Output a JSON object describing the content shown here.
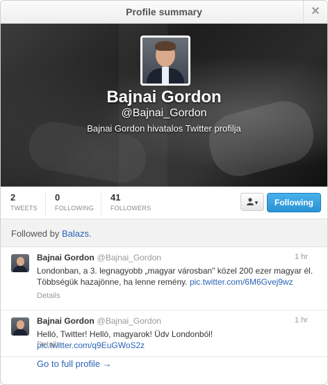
{
  "dialog": {
    "title": "Profile summary",
    "close_glyph": "×"
  },
  "profile": {
    "name": "Bajnai Gordon",
    "handle": "@Bajnai_Gordon",
    "bio": "Bajnai Gordon hivatalos Twitter profilja"
  },
  "stats": [
    {
      "num": "2",
      "label": "TWEETS"
    },
    {
      "num": "0",
      "label": "FOLLOWING"
    },
    {
      "num": "41",
      "label": "FOLLOWERS"
    }
  ],
  "actions": {
    "user_menu_glyph": "▾",
    "follow_label": "Following"
  },
  "followed_by": {
    "prefix": "Followed by ",
    "name": "Balazs",
    "suffix": "."
  },
  "tweets": [
    {
      "name": "Bajnai Gordon",
      "user": "@Bajnai_Gordon",
      "time": "1 hr",
      "text": "Londonban, a 3. legnagyobb „magyar városban\" közel 200 ezer magyar él. Többségük hazajönne, ha lenne remény.",
      "link": "pic.twitter.com/6M6Gvej9wz",
      "details": "Details"
    },
    {
      "name": "Bajnai Gordon",
      "user": "@Bajnai_Gordon",
      "time": "1 hr",
      "text": "Helló, Twitter! Helló, magyarok! Üdv Londonból!",
      "link": "pic.twitter.com/q9EuGWoS2z",
      "details": "Details"
    }
  ],
  "footer": {
    "full_profile": "Go to full profile →"
  },
  "colors": {
    "link": "#2a63b5",
    "follow_button": "#2a93d5"
  }
}
